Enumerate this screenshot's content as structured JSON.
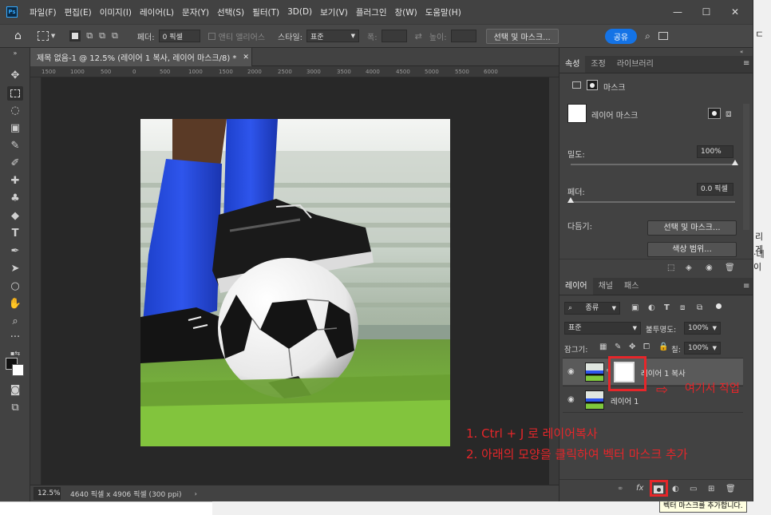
{
  "app": {
    "logo": "Ps",
    "menu": [
      "파일(F)",
      "편집(E)",
      "이미지(I)",
      "레이어(L)",
      "문자(Y)",
      "선택(S)",
      "필터(T)",
      "3D(D)",
      "보기(V)",
      "플러그인",
      "창(W)",
      "도움말(H)"
    ],
    "window_controls": {
      "minimize": "—",
      "maximize": "☐",
      "close": "✕"
    }
  },
  "options": {
    "feather_label": "페더:",
    "feather_value": "0 픽셀",
    "antialias_label": "앤티 앨리어스",
    "style_label": "스타일:",
    "style_value": "표준",
    "width_label": "폭:",
    "height_label": "높이:",
    "select_mask_button": "선택 및 마스크...",
    "share_button": "공유"
  },
  "document": {
    "tab_title": "제목 없음-1 @ 12.5% (레이어 1 복사, 레이어 마스크/8) *",
    "ruler_ticks": [
      "1500",
      "1000",
      "500",
      "0",
      "500",
      "1000",
      "1500",
      "2000",
      "2500",
      "3000",
      "3500",
      "4000",
      "4500",
      "5000",
      "5500",
      "6000"
    ],
    "zoom": "12.5%",
    "doc_info": "4640 픽셀 x 4906 픽셀 (300 ppi)"
  },
  "properties": {
    "tabs": [
      "속성",
      "조정",
      "라이브러리"
    ],
    "section_title": "마스크",
    "mask_name": "레이어 마스크",
    "density_label": "밀도:",
    "density_value": "100%",
    "feather_label": "페더:",
    "feather_value": "0.0 픽셀",
    "refine_label": "다듬기:",
    "select_mask_button": "선택 및 마스크...",
    "color_range_button": "색상 범위...",
    "density_fraction": 1.0,
    "feather_fraction": 0.0
  },
  "layers": {
    "tabs": [
      "레이어",
      "채널",
      "패스"
    ],
    "filter_kind": "종류",
    "blend_mode": "표준",
    "opacity_label": "불투명도:",
    "opacity_value": "100%",
    "lock_label": "잠그기:",
    "fill_label": "칠:",
    "fill_value": "100%",
    "items": [
      {
        "name": "레이어 1 복사",
        "has_mask": true
      },
      {
        "name": "레이어 1",
        "has_mask": false
      }
    ],
    "footer_icons": [
      "link-icon",
      "fx-icon",
      "add-mask-icon",
      "adjustment-icon",
      "folder-icon",
      "new-layer-icon",
      "trash-icon"
    ],
    "fx_label": "fx"
  },
  "annotations": {
    "work_here": "여기서 작업",
    "step1": "1. Ctrl + J 로 레이어복사",
    "step2": "2. 아래의 모양을 클릭하여 벡터 마스크 추가",
    "tooltip": "벡터 마스크를 추가합니다."
  },
  "background_window": {
    "text1": "리게",
    "text2": "·데이"
  },
  "colors": {
    "accent_red": "#e6262a",
    "share_blue": "#1473e6",
    "panel_bg": "#424242",
    "canvas_bg": "#282828"
  }
}
